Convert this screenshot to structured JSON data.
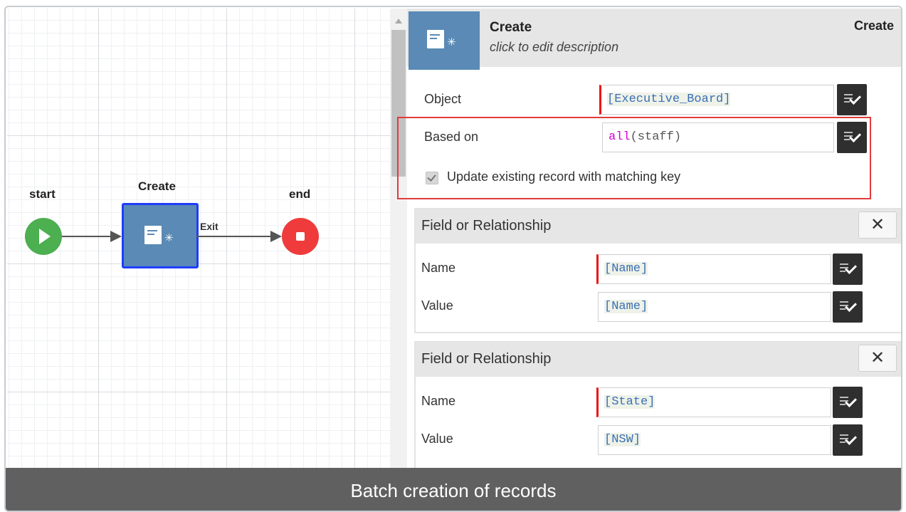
{
  "workflow": {
    "start_label": "start",
    "create_label": "Create",
    "end_label": "end",
    "exit_label": "Exit"
  },
  "panel": {
    "header": {
      "title": "Create",
      "description": "click to edit description",
      "right_label": "Create",
      "icon": "document-sparkle-icon"
    },
    "object": {
      "label": "Object",
      "value": "[Executive_Board]"
    },
    "based_on": {
      "label": "Based on",
      "keyword": "all",
      "argument": "(staff)"
    },
    "update_existing": {
      "label": "Update existing record with matching key",
      "checked": true
    },
    "field_groups": [
      {
        "title": "Field or Relationship",
        "name_label": "Name",
        "name_value": "[Name]",
        "value_label": "Value",
        "value_value": "[Name]",
        "close": "✕"
      },
      {
        "title": "Field or Relationship",
        "name_label": "Name",
        "name_value": "[State]",
        "value_label": "Value",
        "value_value": "[NSW]",
        "close": "✕"
      }
    ]
  },
  "caption": "Batch creation of records",
  "colors": {
    "start": "#4caf50",
    "end": "#ef3b3b",
    "node": "#5a8ab5",
    "node_border": "#1f3dff",
    "highlight": "#e23b3b",
    "required_marker": "#e11111",
    "caption_bg": "#606060"
  }
}
